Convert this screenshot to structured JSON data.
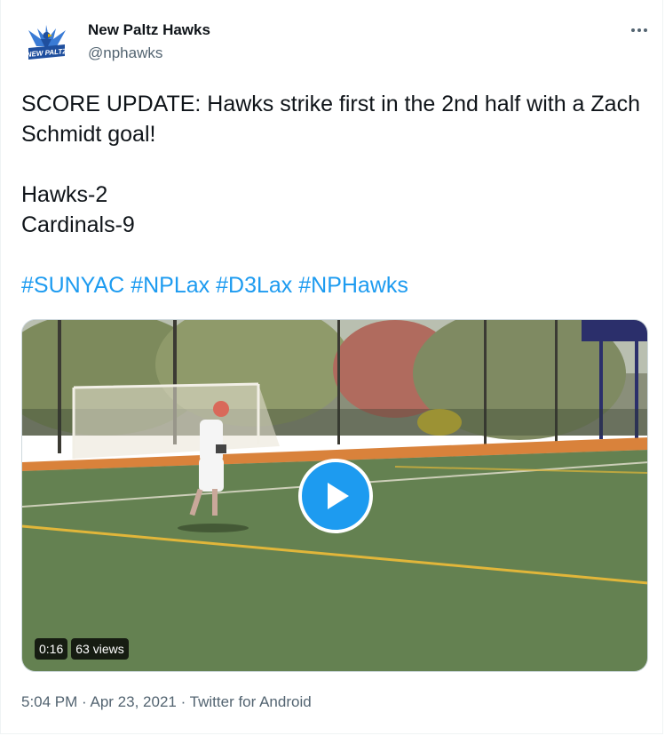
{
  "author": {
    "display_name": "New Paltz Hawks",
    "handle": "@nphawks",
    "avatar_logo_text": "NEW PALTZ"
  },
  "more_icon": "more-horizontal-icon",
  "tweet": {
    "line1": "SCORE UPDATE: Hawks strike first in the 2nd half with a Zach Schmidt goal!",
    "score_home": "Hawks-2",
    "score_away": "Cardinals-9",
    "hashtags": [
      "#SUNYAC",
      "#NPLax",
      "#D3Lax",
      "#NPHawks"
    ]
  },
  "video": {
    "duration": "0:16",
    "views": "63 views",
    "play_icon": "play-icon"
  },
  "meta": {
    "time": "5:04 PM",
    "date": "Apr 23, 2021",
    "source": "Twitter for Android"
  },
  "colors": {
    "accent": "#1d9bf0",
    "text": "#0f1419",
    "secondary": "#536471"
  }
}
